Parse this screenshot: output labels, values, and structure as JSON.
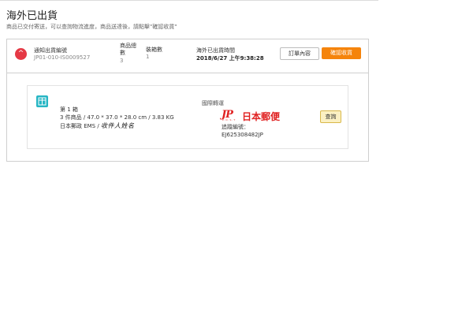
{
  "page": {
    "title": "海外已出貨",
    "subtitle": "商品已交付寄送，可以查詢物流進度，商品送達後，請點擊\"確認收貨\""
  },
  "shipment": {
    "notice_no_label": "通知出貨編號",
    "notice_no_value": "JP01-010-IS0009527",
    "item_count_label_line1": "商品總",
    "item_count_label_line2": "數",
    "item_count_value": "3",
    "box_count_label": "裝箱數",
    "box_count_value": "1",
    "shipped_time_label": "海外已出貨時間",
    "shipped_time_value": "2018/6/27 上午9:38:28",
    "order_button": "訂單內容",
    "confirm_button": "確認收貨",
    "collapse_symbol": "^"
  },
  "box": {
    "title": "第 1 箱",
    "detail": "3 件商品 / 47.0 * 37.0 * 28.0 cm / 3.83 KG",
    "carrier_prefix": "日本郵政 EMS /",
    "recipient": "收件人姓名",
    "transport_label": "國際轉運",
    "carrier_logo_mark": "JP",
    "carrier_logo_sub": "P.O.S.T",
    "carrier_logo_text": "日本郵便",
    "tracking_label": "追蹤編號：",
    "tracking_value": "EJ625308482JP",
    "query_button": "查詢"
  },
  "colors": {
    "accent_orange": "#f5840c",
    "danger_red": "#e53945",
    "jp_red": "#e02020",
    "box_teal": "#27b6c4",
    "query_yellow": "#fbf0c2"
  }
}
